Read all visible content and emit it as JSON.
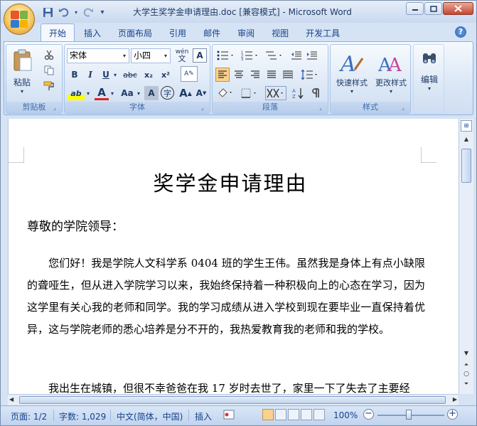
{
  "window": {
    "title": "大学生奖学金申请理由.doc [兼容模式] - Microsoft Word",
    "minimize_icon": "minimize-icon",
    "maximize_icon": "maximize-icon",
    "close_icon": "close-icon"
  },
  "quick_access": {
    "save_icon": "save-icon",
    "undo_icon": "undo-icon",
    "redo_icon": "redo-icon",
    "customize_icon": "customize-arrow-icon"
  },
  "tabs": [
    {
      "label": "开始",
      "active": true
    },
    {
      "label": "插入"
    },
    {
      "label": "页面布局"
    },
    {
      "label": "引用"
    },
    {
      "label": "邮件"
    },
    {
      "label": "审阅"
    },
    {
      "label": "视图"
    },
    {
      "label": "开发工具"
    }
  ],
  "ribbon": {
    "clipboard": {
      "group_label": "剪贴板",
      "paste_label": "粘贴"
    },
    "font": {
      "group_label": "字体",
      "font_name": "宋体",
      "font_size": "小四",
      "phonetic_label": "wén",
      "bold": "B",
      "italic": "I",
      "underline": "U",
      "strike": "abc",
      "subscript": "x₂",
      "superscript": "x²",
      "highlight": "ab",
      "font_color": "A",
      "change_case": "Aa",
      "char_shading": "A",
      "enclose_char": "字",
      "grow_font": "A",
      "shrink_font": "A"
    },
    "paragraph": {
      "group_label": "段落"
    },
    "styles": {
      "group_label": "样式",
      "quick_styles": "快速样式",
      "change_styles": "更改样式"
    },
    "editing": {
      "label": "编辑"
    }
  },
  "document": {
    "title": "奖学金申请理由",
    "salutation": "尊敬的学院领导：",
    "paragraph1": "您们好！我是学院人文科学系 0404 班的学生王伟。虽然我是身体上有点小缺限的聋哑生，但从进入学院学习以来，我始终保持着一种积极向上的心态在学习，因为这学里有关心我的老师和同学。我的学习成绩从进入学校到现在要毕业一直保持着优异，这与学院老师的悉心培养是分不开的，我热爱教育我的老师和我的学校。",
    "paragraph2": "我出生在城镇，但很不幸爸爸在我 17 岁时去世了，家里一下了失去了主要经"
  },
  "status_bar": {
    "page": "页面: 1/2",
    "words": "字数: 1,029",
    "language": "中文(简体，中国)",
    "insert_mode": "插入",
    "zoom": "100%"
  },
  "colors": {
    "ribbon_text": "#15428b",
    "highlight": "#ffff00",
    "font_color": "#e02020",
    "active_align": "#fbd28c"
  }
}
